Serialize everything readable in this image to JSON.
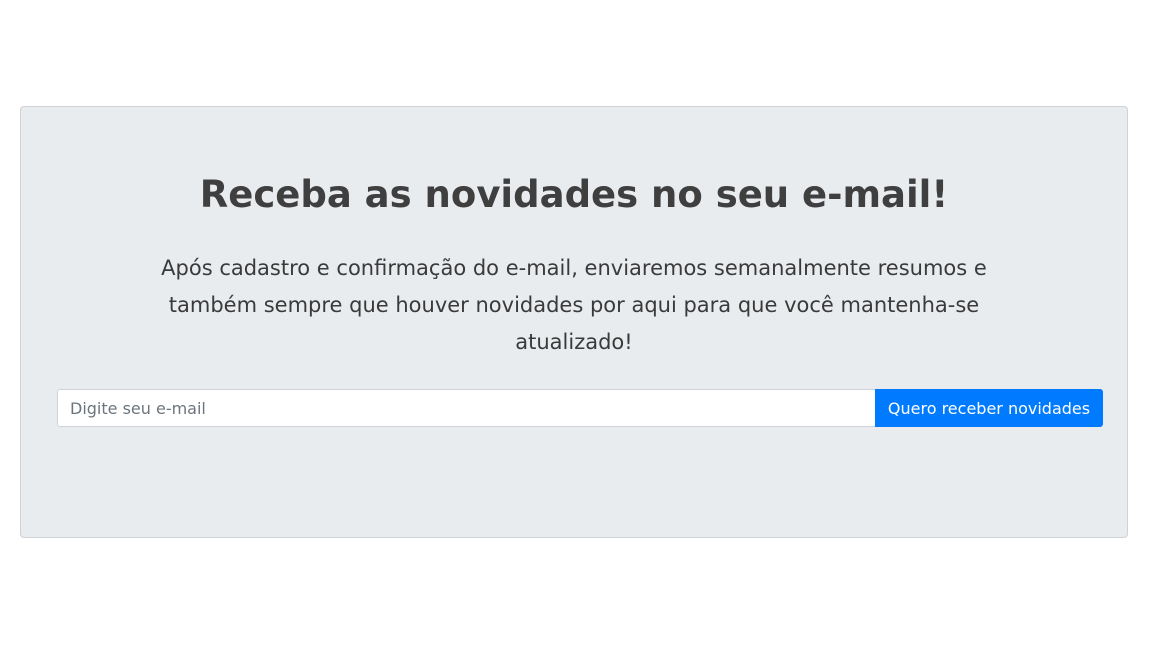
{
  "newsletter": {
    "title": "Receba as novidades no seu e-mail!",
    "description": "Após cadastro e confirmação do e-mail, enviaremos semanalmente resumos e também sempre que houver novidades por aqui para que você mantenha-se atualizado!",
    "email_placeholder": "Digite seu e-mail",
    "email_value": "",
    "submit_label": "Quero receber novidades"
  },
  "colors": {
    "panel_background": "#e9ecef",
    "button_background": "#007bff",
    "heading_text": "#3f3f3f"
  }
}
